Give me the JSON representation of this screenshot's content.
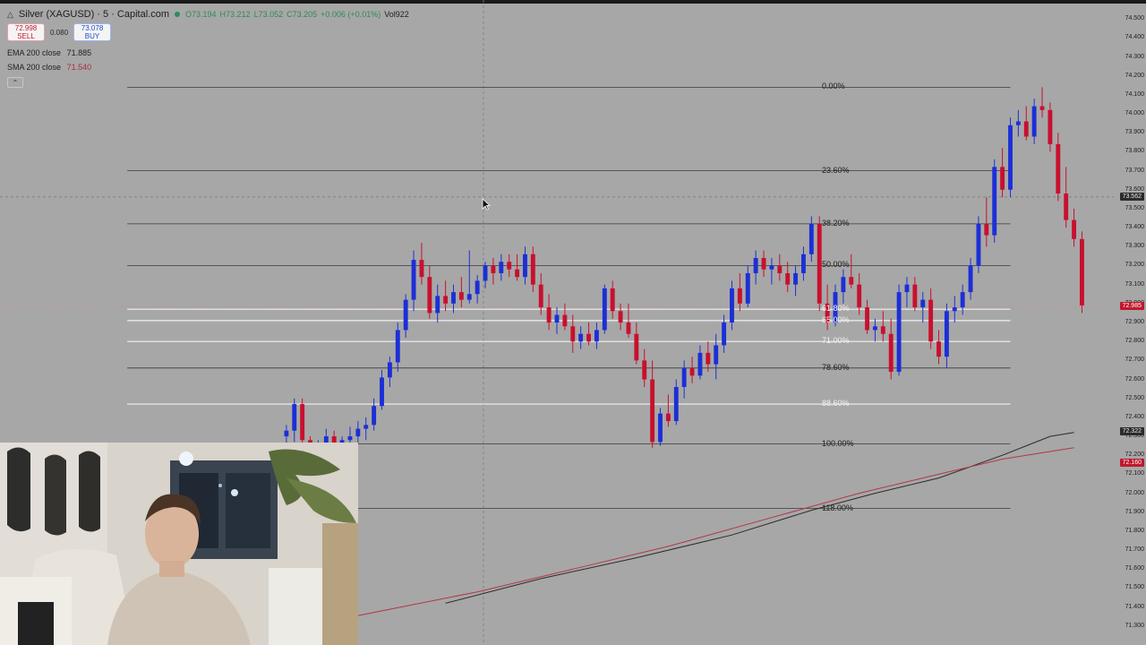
{
  "header": {
    "title": "Silver (XAGUSD) · 5 · Capital.com",
    "ohlc": {
      "open": "O73.194",
      "high": "H73.212",
      "low": "L73.052",
      "close": "C73.205",
      "change": "+0.006 (+0.01%)",
      "volume": "Vol922"
    }
  },
  "trade": {
    "sell_price": "72.998",
    "sell_label": "SELL",
    "spread": "0.080",
    "buy_price": "73.078",
    "buy_label": "BUY"
  },
  "indicators": [
    {
      "label": "EMA 200 close",
      "value": "71.885"
    },
    {
      "label": "SMA 200 close",
      "value": "71.540"
    }
  ],
  "fib_levels": [
    {
      "label": "0.00%",
      "price": 74.14,
      "style": "dark"
    },
    {
      "label": "23.60%",
      "price": 73.7,
      "style": "dark"
    },
    {
      "label": "38.20%",
      "price": 73.42,
      "style": "dark"
    },
    {
      "label": "50.00%",
      "price": 73.2,
      "style": "dark"
    },
    {
      "label": "61.80%",
      "price": 72.97,
      "style": "light"
    },
    {
      "label": "65.00%",
      "price": 72.91,
      "style": "light"
    },
    {
      "label": "71.00%",
      "price": 72.8,
      "style": "light"
    },
    {
      "label": "78.60%",
      "price": 72.66,
      "style": "dark"
    },
    {
      "label": "88.60%",
      "price": 72.47,
      "style": "light"
    },
    {
      "label": "100.00%",
      "price": 72.26,
      "style": "dark"
    },
    {
      "label": "118.00%",
      "price": 71.92,
      "style": "dark"
    }
  ],
  "price_axis": {
    "min": 71.2,
    "max": 74.6,
    "ticks": [
      "74.500",
      "74.400",
      "74.300",
      "74.200",
      "74.100",
      "74.000",
      "73.900",
      "73.800",
      "73.700",
      "73.600",
      "73.500",
      "73.400",
      "73.300",
      "73.200",
      "73.100",
      "73.000",
      "72.900",
      "72.800",
      "72.700",
      "72.600",
      "72.500",
      "72.400",
      "72.300",
      "72.200",
      "72.100",
      "72.000",
      "71.900",
      "71.800",
      "71.700",
      "71.600",
      "71.500",
      "71.400",
      "71.300"
    ],
    "tags": [
      {
        "text": "73.562",
        "price": 73.562,
        "style": "dark"
      },
      {
        "text": "72.985",
        "price": 72.985,
        "style": "red"
      },
      {
        "text": "72.322",
        "price": 72.322,
        "style": "dark"
      },
      {
        "text": "72.160",
        "price": 72.16,
        "style": "red"
      }
    ]
  },
  "chart_data": {
    "type": "candlestick",
    "up_color": "#1c2fd6",
    "down_color": "#c8102e",
    "candles": [
      {
        "o": 72.3,
        "h": 72.36,
        "l": 72.26,
        "c": 72.33
      },
      {
        "o": 72.33,
        "h": 72.5,
        "l": 72.27,
        "c": 72.47
      },
      {
        "o": 72.47,
        "h": 72.5,
        "l": 72.25,
        "c": 72.28
      },
      {
        "o": 72.28,
        "h": 72.3,
        "l": 72.2,
        "c": 72.24
      },
      {
        "o": 72.24,
        "h": 72.28,
        "l": 72.18,
        "c": 72.26
      },
      {
        "o": 72.26,
        "h": 72.34,
        "l": 72.22,
        "c": 72.3
      },
      {
        "o": 72.3,
        "h": 72.33,
        "l": 72.22,
        "c": 72.25
      },
      {
        "o": 72.25,
        "h": 72.3,
        "l": 72.2,
        "c": 72.28
      },
      {
        "o": 72.28,
        "h": 72.35,
        "l": 72.24,
        "c": 72.3
      },
      {
        "o": 72.3,
        "h": 72.38,
        "l": 72.26,
        "c": 72.34
      },
      {
        "o": 72.34,
        "h": 72.4,
        "l": 72.28,
        "c": 72.36
      },
      {
        "o": 72.36,
        "h": 72.5,
        "l": 72.33,
        "c": 72.46
      },
      {
        "o": 72.46,
        "h": 72.65,
        "l": 72.44,
        "c": 72.61
      },
      {
        "o": 72.61,
        "h": 72.72,
        "l": 72.56,
        "c": 72.69
      },
      {
        "o": 72.69,
        "h": 72.9,
        "l": 72.64,
        "c": 72.86
      },
      {
        "o": 72.86,
        "h": 73.05,
        "l": 72.82,
        "c": 73.02
      },
      {
        "o": 73.02,
        "h": 73.28,
        "l": 72.96,
        "c": 73.23
      },
      {
        "o": 73.23,
        "h": 73.32,
        "l": 73.1,
        "c": 73.14
      },
      {
        "o": 73.14,
        "h": 73.2,
        "l": 72.92,
        "c": 72.95
      },
      {
        "o": 72.95,
        "h": 73.1,
        "l": 72.9,
        "c": 73.04
      },
      {
        "o": 73.04,
        "h": 73.12,
        "l": 72.96,
        "c": 73.0
      },
      {
        "o": 73.0,
        "h": 73.1,
        "l": 72.95,
        "c": 73.06
      },
      {
        "o": 73.06,
        "h": 73.14,
        "l": 72.98,
        "c": 73.02
      },
      {
        "o": 73.02,
        "h": 73.28,
        "l": 73.0,
        "c": 73.05
      },
      {
        "o": 73.05,
        "h": 73.15,
        "l": 73.0,
        "c": 73.12
      },
      {
        "o": 73.12,
        "h": 73.22,
        "l": 73.08,
        "c": 73.2
      },
      {
        "o": 73.2,
        "h": 73.24,
        "l": 73.1,
        "c": 73.16
      },
      {
        "o": 73.16,
        "h": 73.26,
        "l": 73.12,
        "c": 73.22
      },
      {
        "o": 73.22,
        "h": 73.26,
        "l": 73.14,
        "c": 73.18
      },
      {
        "o": 73.18,
        "h": 73.26,
        "l": 73.12,
        "c": 73.14
      },
      {
        "o": 73.14,
        "h": 73.3,
        "l": 73.1,
        "c": 73.26
      },
      {
        "o": 73.26,
        "h": 73.3,
        "l": 73.06,
        "c": 73.1
      },
      {
        "o": 73.1,
        "h": 73.16,
        "l": 72.94,
        "c": 72.98
      },
      {
        "o": 72.98,
        "h": 73.05,
        "l": 72.86,
        "c": 72.9
      },
      {
        "o": 72.9,
        "h": 72.98,
        "l": 72.84,
        "c": 72.94
      },
      {
        "o": 72.94,
        "h": 73.0,
        "l": 72.86,
        "c": 72.88
      },
      {
        "o": 72.88,
        "h": 72.94,
        "l": 72.74,
        "c": 72.8
      },
      {
        "o": 72.8,
        "h": 72.88,
        "l": 72.76,
        "c": 72.84
      },
      {
        "o": 72.84,
        "h": 72.9,
        "l": 72.78,
        "c": 72.8
      },
      {
        "o": 72.8,
        "h": 72.9,
        "l": 72.76,
        "c": 72.86
      },
      {
        "o": 72.86,
        "h": 73.1,
        "l": 72.84,
        "c": 73.08
      },
      {
        "o": 73.08,
        "h": 73.12,
        "l": 72.92,
        "c": 72.96
      },
      {
        "o": 72.96,
        "h": 73.0,
        "l": 72.86,
        "c": 72.9
      },
      {
        "o": 72.9,
        "h": 73.0,
        "l": 72.82,
        "c": 72.84
      },
      {
        "o": 72.84,
        "h": 72.9,
        "l": 72.68,
        "c": 72.7
      },
      {
        "o": 72.7,
        "h": 72.76,
        "l": 72.56,
        "c": 72.6
      },
      {
        "o": 72.6,
        "h": 72.7,
        "l": 72.24,
        "c": 72.27
      },
      {
        "o": 72.27,
        "h": 72.45,
        "l": 72.25,
        "c": 72.42
      },
      {
        "o": 72.42,
        "h": 72.52,
        "l": 72.35,
        "c": 72.38
      },
      {
        "o": 72.38,
        "h": 72.6,
        "l": 72.36,
        "c": 72.56
      },
      {
        "o": 72.56,
        "h": 72.7,
        "l": 72.5,
        "c": 72.66
      },
      {
        "o": 72.66,
        "h": 72.72,
        "l": 72.58,
        "c": 72.62
      },
      {
        "o": 72.62,
        "h": 72.78,
        "l": 72.6,
        "c": 72.74
      },
      {
        "o": 72.74,
        "h": 72.8,
        "l": 72.64,
        "c": 72.68
      },
      {
        "o": 72.68,
        "h": 72.84,
        "l": 72.6,
        "c": 72.78
      },
      {
        "o": 72.78,
        "h": 72.94,
        "l": 72.74,
        "c": 72.9
      },
      {
        "o": 72.9,
        "h": 73.12,
        "l": 72.86,
        "c": 73.08
      },
      {
        "o": 73.08,
        "h": 73.16,
        "l": 72.96,
        "c": 73.0
      },
      {
        "o": 73.0,
        "h": 73.2,
        "l": 72.98,
        "c": 73.16
      },
      {
        "o": 73.16,
        "h": 73.28,
        "l": 73.1,
        "c": 73.24
      },
      {
        "o": 73.24,
        "h": 73.28,
        "l": 73.14,
        "c": 73.18
      },
      {
        "o": 73.18,
        "h": 73.24,
        "l": 73.1,
        "c": 73.2
      },
      {
        "o": 73.2,
        "h": 73.26,
        "l": 73.12,
        "c": 73.16
      },
      {
        "o": 73.16,
        "h": 73.22,
        "l": 73.06,
        "c": 73.1
      },
      {
        "o": 73.1,
        "h": 73.2,
        "l": 73.04,
        "c": 73.16
      },
      {
        "o": 73.16,
        "h": 73.3,
        "l": 73.12,
        "c": 73.26
      },
      {
        "o": 73.26,
        "h": 73.46,
        "l": 73.22,
        "c": 73.42
      },
      {
        "o": 73.42,
        "h": 73.46,
        "l": 72.96,
        "c": 73.0
      },
      {
        "o": 73.0,
        "h": 73.1,
        "l": 72.86,
        "c": 72.9
      },
      {
        "o": 72.9,
        "h": 73.1,
        "l": 72.88,
        "c": 73.06
      },
      {
        "o": 73.06,
        "h": 73.18,
        "l": 73.0,
        "c": 73.14
      },
      {
        "o": 73.14,
        "h": 73.26,
        "l": 73.08,
        "c": 73.1
      },
      {
        "o": 73.1,
        "h": 73.16,
        "l": 72.94,
        "c": 72.98
      },
      {
        "o": 72.98,
        "h": 73.02,
        "l": 72.84,
        "c": 72.86
      },
      {
        "o": 72.86,
        "h": 72.92,
        "l": 72.8,
        "c": 72.88
      },
      {
        "o": 72.88,
        "h": 72.96,
        "l": 72.8,
        "c": 72.84
      },
      {
        "o": 72.84,
        "h": 72.92,
        "l": 72.6,
        "c": 72.64
      },
      {
        "o": 72.64,
        "h": 73.1,
        "l": 72.62,
        "c": 73.06
      },
      {
        "o": 73.06,
        "h": 73.14,
        "l": 72.98,
        "c": 73.1
      },
      {
        "o": 73.1,
        "h": 73.14,
        "l": 72.96,
        "c": 72.98
      },
      {
        "o": 72.98,
        "h": 73.06,
        "l": 72.9,
        "c": 73.02
      },
      {
        "o": 73.02,
        "h": 73.08,
        "l": 72.76,
        "c": 72.8
      },
      {
        "o": 72.8,
        "h": 72.86,
        "l": 72.68,
        "c": 72.72
      },
      {
        "o": 72.72,
        "h": 73.0,
        "l": 72.66,
        "c": 72.96
      },
      {
        "o": 72.96,
        "h": 73.04,
        "l": 72.9,
        "c": 72.98
      },
      {
        "o": 72.98,
        "h": 73.1,
        "l": 72.94,
        "c": 73.06
      },
      {
        "o": 73.06,
        "h": 73.24,
        "l": 73.02,
        "c": 73.2
      },
      {
        "o": 73.2,
        "h": 73.46,
        "l": 73.16,
        "c": 73.42
      },
      {
        "o": 73.42,
        "h": 73.56,
        "l": 73.3,
        "c": 73.36
      },
      {
        "o": 73.36,
        "h": 73.76,
        "l": 73.32,
        "c": 73.72
      },
      {
        "o": 73.72,
        "h": 73.82,
        "l": 73.56,
        "c": 73.6
      },
      {
        "o": 73.6,
        "h": 73.98,
        "l": 73.56,
        "c": 73.94
      },
      {
        "o": 73.94,
        "h": 74.02,
        "l": 73.88,
        "c": 73.96
      },
      {
        "o": 73.96,
        "h": 74.04,
        "l": 73.86,
        "c": 73.88
      },
      {
        "o": 73.88,
        "h": 74.08,
        "l": 73.84,
        "c": 74.04
      },
      {
        "o": 74.04,
        "h": 74.14,
        "l": 73.98,
        "c": 74.02
      },
      {
        "o": 74.02,
        "h": 74.06,
        "l": 73.8,
        "c": 73.84
      },
      {
        "o": 73.84,
        "h": 73.9,
        "l": 73.54,
        "c": 73.58
      },
      {
        "o": 73.58,
        "h": 73.72,
        "l": 73.4,
        "c": 73.44
      },
      {
        "o": 73.44,
        "h": 73.5,
        "l": 73.3,
        "c": 73.34
      },
      {
        "o": 73.34,
        "h": 73.38,
        "l": 72.95,
        "c": 72.99
      }
    ],
    "ema200": [
      [
        20,
        71.42
      ],
      [
        32,
        71.55
      ],
      [
        44,
        71.66
      ],
      [
        56,
        71.78
      ],
      [
        66,
        71.91
      ],
      [
        74,
        72.0
      ],
      [
        82,
        72.08
      ],
      [
        90,
        72.2
      ],
      [
        96,
        72.3
      ],
      [
        99,
        72.32
      ]
    ],
    "sma200": [
      [
        0,
        71.28
      ],
      [
        12,
        71.38
      ],
      [
        24,
        71.48
      ],
      [
        36,
        71.6
      ],
      [
        48,
        71.72
      ],
      [
        60,
        71.86
      ],
      [
        72,
        72.0
      ],
      [
        82,
        72.1
      ],
      [
        90,
        72.18
      ],
      [
        99,
        72.24
      ]
    ],
    "xlim": [
      -36,
      104
    ],
    "ylim": [
      71.2,
      74.6
    ],
    "fib_range": [
      -20,
      91
    ]
  },
  "colors": {
    "background": "#a7a7a7",
    "ema_line": "#2b2b2b",
    "sma_line": "#b3364a",
    "fib_dark": "#3a3a3a",
    "fib_light": "#f2f2f2"
  }
}
